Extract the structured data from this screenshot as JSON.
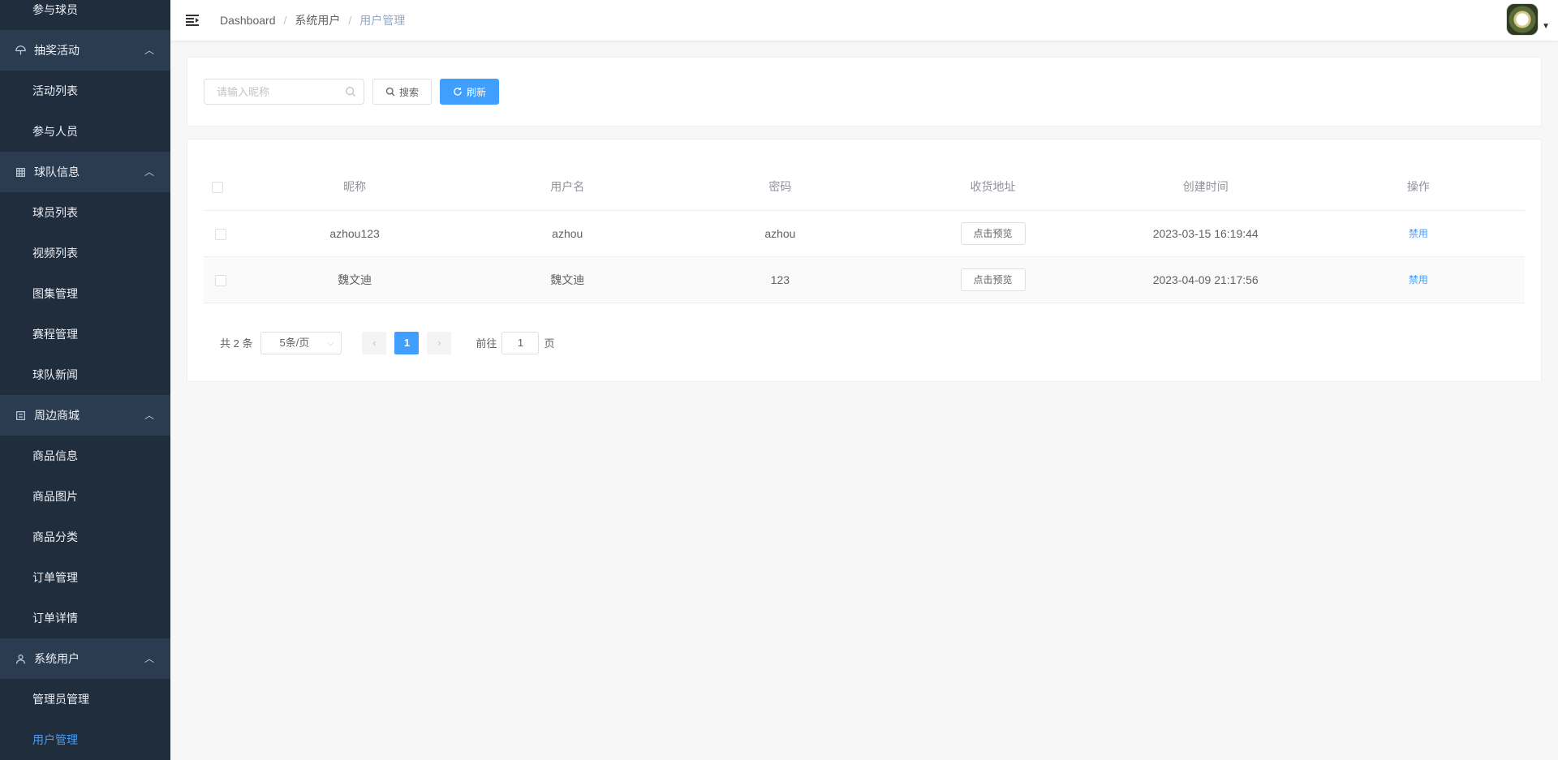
{
  "sidebar": {
    "items": [
      {
        "type": "item",
        "label": "参与球员"
      },
      {
        "type": "group",
        "label": "抽奖活动",
        "icon": "umbrella-icon"
      },
      {
        "type": "item",
        "label": "活动列表"
      },
      {
        "type": "item",
        "label": "参与人员"
      },
      {
        "type": "group",
        "label": "球队信息",
        "icon": "building-icon"
      },
      {
        "type": "item",
        "label": "球员列表"
      },
      {
        "type": "item",
        "label": "视频列表"
      },
      {
        "type": "item",
        "label": "图集管理"
      },
      {
        "type": "item",
        "label": "赛程管理"
      },
      {
        "type": "item",
        "label": "球队新闻"
      },
      {
        "type": "group",
        "label": "周边商城",
        "icon": "shop-icon"
      },
      {
        "type": "item",
        "label": "商品信息"
      },
      {
        "type": "item",
        "label": "商品图片"
      },
      {
        "type": "item",
        "label": "商品分类"
      },
      {
        "type": "item",
        "label": "订单管理"
      },
      {
        "type": "item",
        "label": "订单详情"
      },
      {
        "type": "group",
        "label": "系统用户",
        "icon": "user-icon"
      },
      {
        "type": "item",
        "label": "管理员管理"
      },
      {
        "type": "item",
        "label": "用户管理",
        "active": true
      }
    ]
  },
  "header": {
    "breadcrumb": [
      "Dashboard",
      "系统用户",
      "用户管理"
    ],
    "separator": "/"
  },
  "filter": {
    "search_placeholder": "请输入昵称",
    "search_label": "搜索",
    "refresh_label": "刷新"
  },
  "table": {
    "columns": [
      "昵称",
      "用户名",
      "密码",
      "收货地址",
      "创建时间",
      "操作"
    ],
    "rows": [
      {
        "nickname": "azhou123",
        "username": "azhou",
        "password": "azhou",
        "address_btn": "点击预览",
        "created": "2023-03-15 16:19:44",
        "action": "禁用"
      },
      {
        "nickname": "魏文迪",
        "username": "魏文迪",
        "password": "123",
        "address_btn": "点击预览",
        "created": "2023-04-09 21:17:56",
        "action": "禁用"
      }
    ]
  },
  "pagination": {
    "total": "共 2 条",
    "page_size": "5条/页",
    "current_page": "1",
    "goto_prefix": "前往",
    "goto_value": "1",
    "goto_suffix": "页"
  },
  "colors": {
    "sidebar_bg": "#1f2d3d",
    "group_bg": "#2c3c50",
    "accent": "#409eff"
  }
}
